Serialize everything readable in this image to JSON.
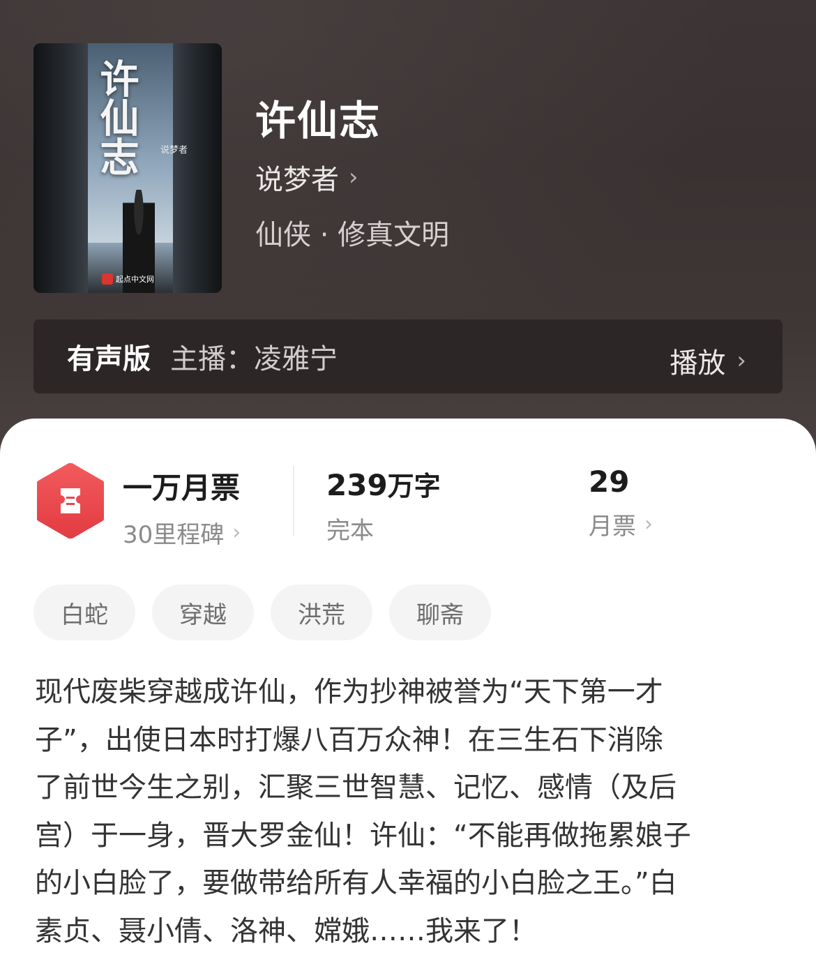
{
  "book": {
    "title": "许仙志",
    "author": "说梦者",
    "genre": "仙侠 · 修真文明",
    "cover": {
      "title_text": "许仙志",
      "author_text": "说梦者",
      "publisher_text": "起点中文网"
    }
  },
  "audio": {
    "label": "有声版",
    "host": "主播：凌雅宁",
    "play_label": "播放"
  },
  "stats": {
    "tickets": {
      "title": "一万月票",
      "sub": "30里程碑"
    },
    "words": {
      "number": "239",
      "unit": "万字",
      "status": "完本"
    },
    "monthly": {
      "number": "29",
      "label": "月票"
    }
  },
  "tags": [
    "白蛇",
    "穿越",
    "洪荒",
    "聊斋"
  ],
  "description": {
    "lines": [
      "现代废柴穿越成许仙，作为抄神被誉为“天下第一才",
      "子”，出使日本时打爆八百万众神！在三生石下消除",
      "了前世今生之别，汇聚三世智慧、记忆、感情（及后",
      "宫）于一身，晋大罗金仙！许仙：“不能再做拖累娘子",
      "的小白脸了，要做带给所有人幸福的小白脸之王。”白",
      "素贞、聂小倩、洛神、嫦娥……我来了！"
    ]
  },
  "colors": {
    "hero_bg": "#3d3535",
    "audio_bar_bg": "#2c2626",
    "ticket_red": "#e8464a",
    "tag_bg": "#f4f4f4"
  },
  "icons": {
    "ticket": "ticket-icon",
    "chevron": "chevron-right-icon"
  }
}
